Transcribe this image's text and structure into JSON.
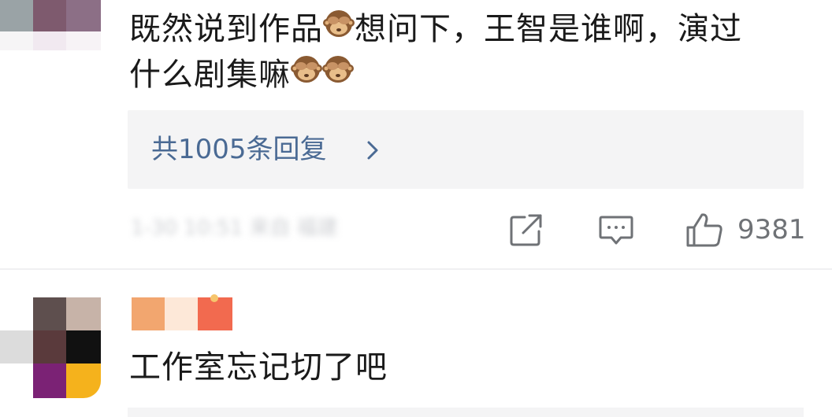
{
  "comment1": {
    "line1": "既然说到作品",
    "line1b": "想问下，王智是谁啊，演过",
    "line2": "什么剧集嘛",
    "emoji": "see-no-evil-monkey"
  },
  "reply_thread": {
    "label": "共1005条回复",
    "chevron": "chevron-right-icon"
  },
  "meta": {
    "blurred_text": "1-30 10:51 来自 福建"
  },
  "actions": {
    "share_icon": "share-icon",
    "comment_icon": "comment-icon",
    "like_icon": "thumbs-up-icon",
    "like_count": "9381"
  },
  "comment2": {
    "text": "工作室忘记切了吧"
  },
  "colors": {
    "link": "#4a6a94",
    "text": "#1a1a1a",
    "muted": "#6f7276",
    "reply_bg": "#f4f4f5"
  }
}
